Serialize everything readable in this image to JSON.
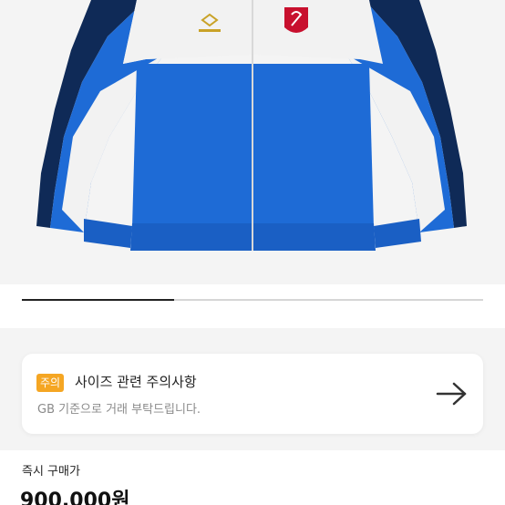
{
  "notice": {
    "badge": "주의",
    "title": "사이즈 관련 주의사항",
    "subtitle": "GB 기준으로 거래 부탁드립니다.",
    "arrow_icon": "arrow-right-icon"
  },
  "price": {
    "label": "즉시 구매가",
    "value": "900,000원"
  },
  "carousel": {
    "progress": 0.33
  },
  "colors": {
    "jacket_blue": "#1e6bd6",
    "jacket_navy": "#0f2a57",
    "jacket_white": "#f2f2f2",
    "badge_orange": "#f5a623"
  }
}
